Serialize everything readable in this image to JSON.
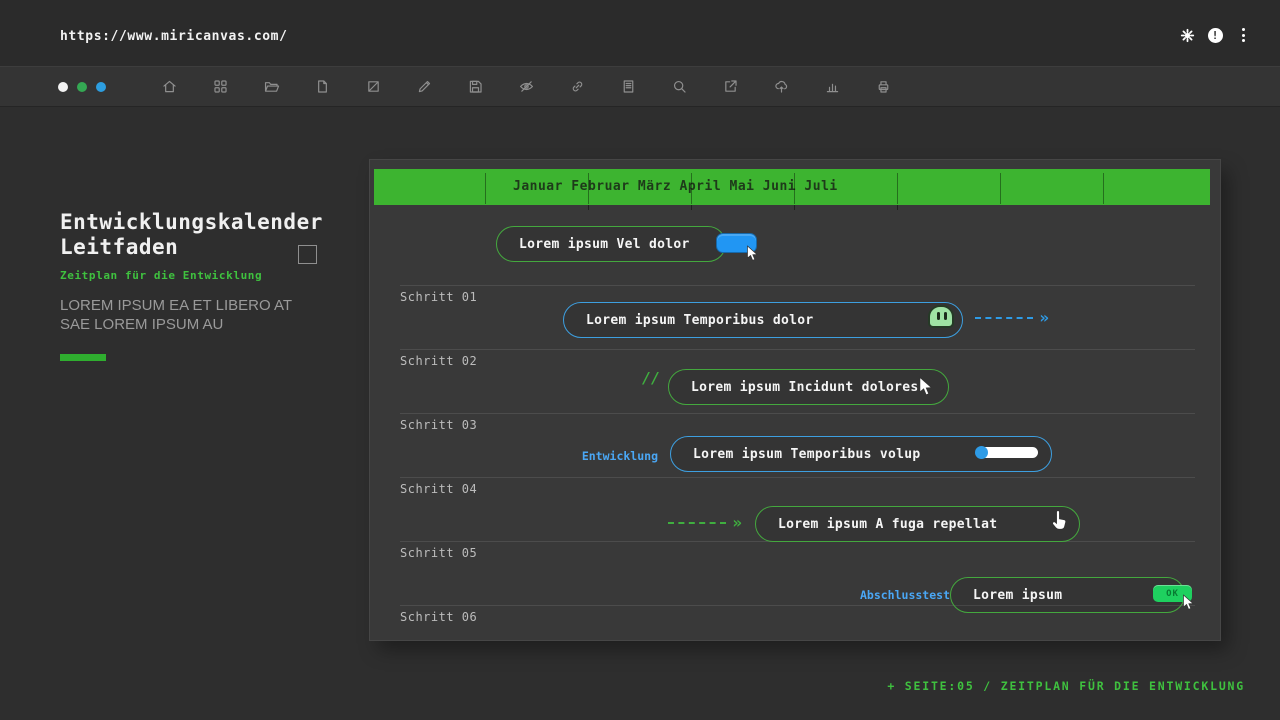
{
  "browser": {
    "url": "https://www.miricanvas.com/",
    "top_icons": [
      "gear-icon",
      "info-icon",
      "kebab-menu-icon"
    ]
  },
  "toolbar": {
    "dots": [
      "#f3f3f3",
      "#34a853",
      "#2d9ee0"
    ],
    "icons": [
      "home",
      "grid",
      "folder",
      "file",
      "crop",
      "pen",
      "save",
      "eye-off",
      "link",
      "notes",
      "search",
      "share",
      "cloud-upload",
      "chart",
      "printer"
    ]
  },
  "sidebar": {
    "title": "Entwicklungskalender\nLeitfaden",
    "subtitle": "Zeitplan für die Entwicklung",
    "body": "LOREM IPSUM EA ET LIBERO AT SAE LOREM IPSUM AU"
  },
  "canvas": {
    "months": "Januar Februar März April Mai Juni Juli",
    "steps": [
      "Schritt 01",
      "Schritt 02",
      "Schritt 03",
      "Schritt 04",
      "Schritt 05",
      "Schritt 06"
    ],
    "pills": [
      {
        "label": "Lorem ipsum Vel dolor",
        "style": "green",
        "accessory": "toggle-button"
      },
      {
        "label": "Lorem ipsum Temporibus dolor",
        "style": "blue",
        "accessory": "blob-sticker"
      },
      {
        "label": "Lorem ipsum Incidunt dolores",
        "style": "green",
        "prefix": "//"
      },
      {
        "label": "Lorem ipsum Temporibus volup",
        "style": "blue",
        "tag": "Entwicklung",
        "accessory": "progress-slider"
      },
      {
        "label": "Lorem ipsum A fuga repellat",
        "style": "green"
      },
      {
        "label": "Lorem ipsum",
        "style": "green",
        "tag": "Abschlusstest",
        "button": "OK"
      }
    ]
  },
  "footer": {
    "text": "+ SEITE:05 / ZEITPLAN FÜR DIE ENTWICKLUNG"
  },
  "colors": {
    "bar_green": "#3db430",
    "pill_green": "#44a83e",
    "pill_blue": "#3d9fe0",
    "label_blue": "#4aa7f5",
    "footer_green": "#3fc13f",
    "ok_green": "#1ed05f",
    "btn_blue": "#2196f3",
    "arrow_blue": "#2e9be6",
    "arrow_green": "#3fae3f",
    "month_text": "#1e3a1a"
  }
}
